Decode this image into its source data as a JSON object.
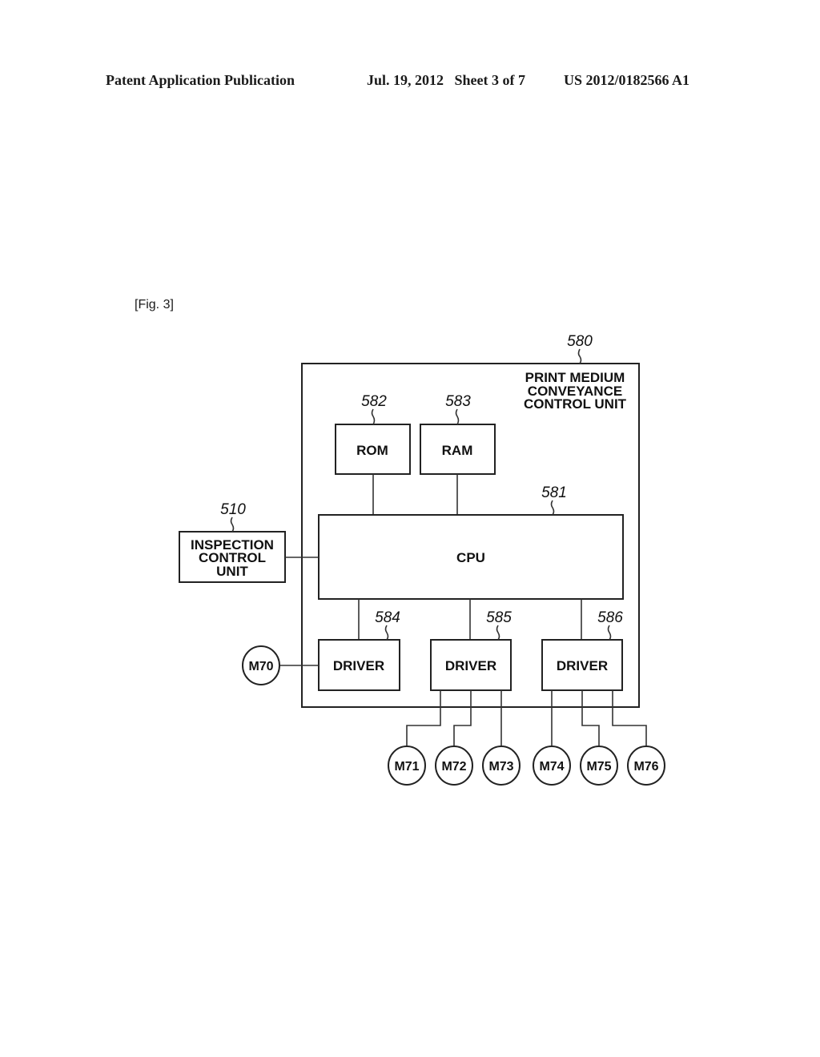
{
  "header": {
    "publication": "Patent Application Publication",
    "date_sheet": "Jul. 19, 2012   Sheet 3 of 7",
    "number": "US 2012/0182566 A1"
  },
  "figure_label": "[Fig. 3]",
  "diagram": {
    "outer_unit": {
      "ref": "580",
      "title_lines": [
        "PRINT MEDIUM",
        "CONVEYANCE",
        "CONTROL UNIT"
      ]
    },
    "rom": {
      "ref": "582",
      "label": "ROM"
    },
    "ram": {
      "ref": "583",
      "label": "RAM"
    },
    "cpu": {
      "ref": "581",
      "label": "CPU"
    },
    "inspection": {
      "ref": "510",
      "label_lines": [
        "INSPECTION",
        "CONTROL",
        "UNIT"
      ]
    },
    "drivers": [
      {
        "ref": "584",
        "label": "DRIVER"
      },
      {
        "ref": "585",
        "label": "DRIVER"
      },
      {
        "ref": "586",
        "label": "DRIVER"
      }
    ],
    "motors": [
      "M70",
      "M71",
      "M72",
      "M73",
      "M74",
      "M75",
      "M76"
    ]
  }
}
